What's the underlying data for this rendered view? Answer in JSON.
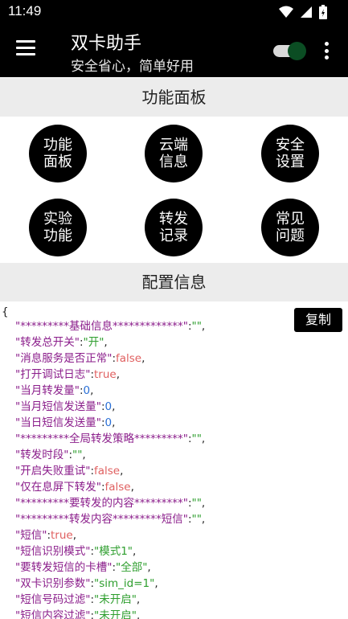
{
  "status_bar": {
    "time": "11:49"
  },
  "app_bar": {
    "title": "双卡助手",
    "subtitle": "安全省心，简单好用",
    "toggle_on": true,
    "toggle_color": "#0b4d23"
  },
  "panel": {
    "title": "功能面板",
    "buttons": [
      "功能面板",
      "云端信息",
      "安全设置",
      "实验功能",
      "转发记录",
      "常见问题"
    ]
  },
  "config": {
    "title": "配置信息",
    "copy_label": "复制",
    "open_brace": "{",
    "lines": [
      {
        "key": "*********基础信息*************",
        "value": "\"\"",
        "type": "s"
      },
      {
        "key": "转发总开关",
        "value": "\"开\"",
        "type": "s"
      },
      {
        "key": "消息服务是否正常",
        "value": "false",
        "type": "b"
      },
      {
        "key": "打开调试日志",
        "value": "true",
        "type": "b"
      },
      {
        "key": "当月转发量",
        "value": "0",
        "type": "n"
      },
      {
        "key": "当月短信发送量",
        "value": "0",
        "type": "n"
      },
      {
        "key": "当日短信发送量",
        "value": "0",
        "type": "n"
      },
      {
        "key": "*********全局转发策略*********",
        "value": "\"\"",
        "type": "s"
      },
      {
        "key": "转发时段",
        "value": "\"\"",
        "type": "s"
      },
      {
        "key": "开启失败重试",
        "value": "false",
        "type": "b"
      },
      {
        "key": "仅在息屏下转发",
        "value": "false",
        "type": "b"
      },
      {
        "key": "*********要转发的内容*********",
        "value": "\"\"",
        "type": "s"
      },
      {
        "key": "*********转发内容*********短信",
        "value": "\"\"",
        "type": "s"
      },
      {
        "key": "短信",
        "value": "true",
        "type": "b"
      },
      {
        "key": "短信识别模式",
        "value": "\"模式1\"",
        "type": "s"
      },
      {
        "key": "要转发短信的卡槽",
        "value": "\"全部\"",
        "type": "s"
      },
      {
        "key": "双卡识别参数",
        "value": "\"sim_id=1\"",
        "type": "s"
      },
      {
        "key": "短信号码过滤",
        "value": "\"未开启\"",
        "type": "s"
      },
      {
        "key": "短信内容过滤",
        "value": "\"未开启\"",
        "type": "s"
      }
    ]
  }
}
